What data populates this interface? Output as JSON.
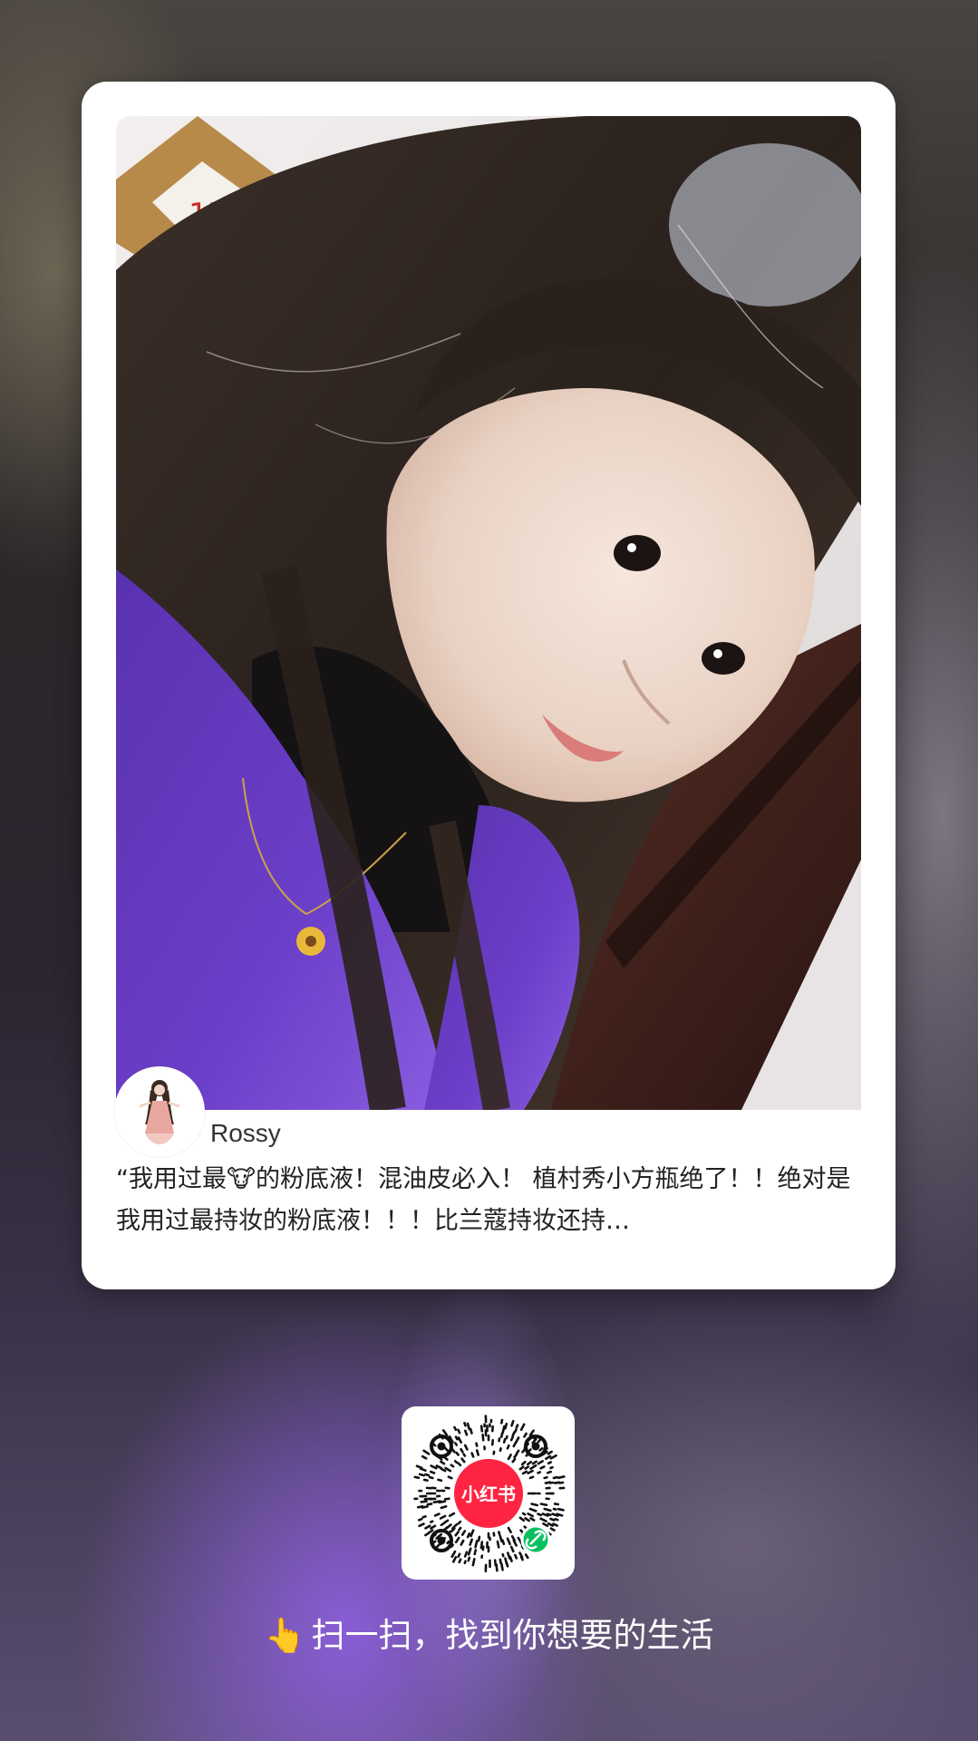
{
  "card": {
    "author": "Rossy",
    "caption": "“我用过最🐮的粉底液！混油皮必入！ 植村秀小方瓶绝了！！绝对是我用过最持妆的粉底液！！！比兰蔻持妆还持…",
    "photo_icon": "selfie-photo",
    "avatar_icon": "avatar-girl-figure"
  },
  "qr": {
    "brand_label": "小红书",
    "brand_color": "#FF2442",
    "mini_program_badge_color": "#07C160",
    "mini_program_icon": "link-icon"
  },
  "footer": {
    "hand_icon": "👆",
    "slogan": "扫一扫，找到你想要的生活"
  },
  "colors": {
    "card_background": "#FFFFFF",
    "sweater": "#6B3FC8",
    "hair": "#2A211C"
  }
}
